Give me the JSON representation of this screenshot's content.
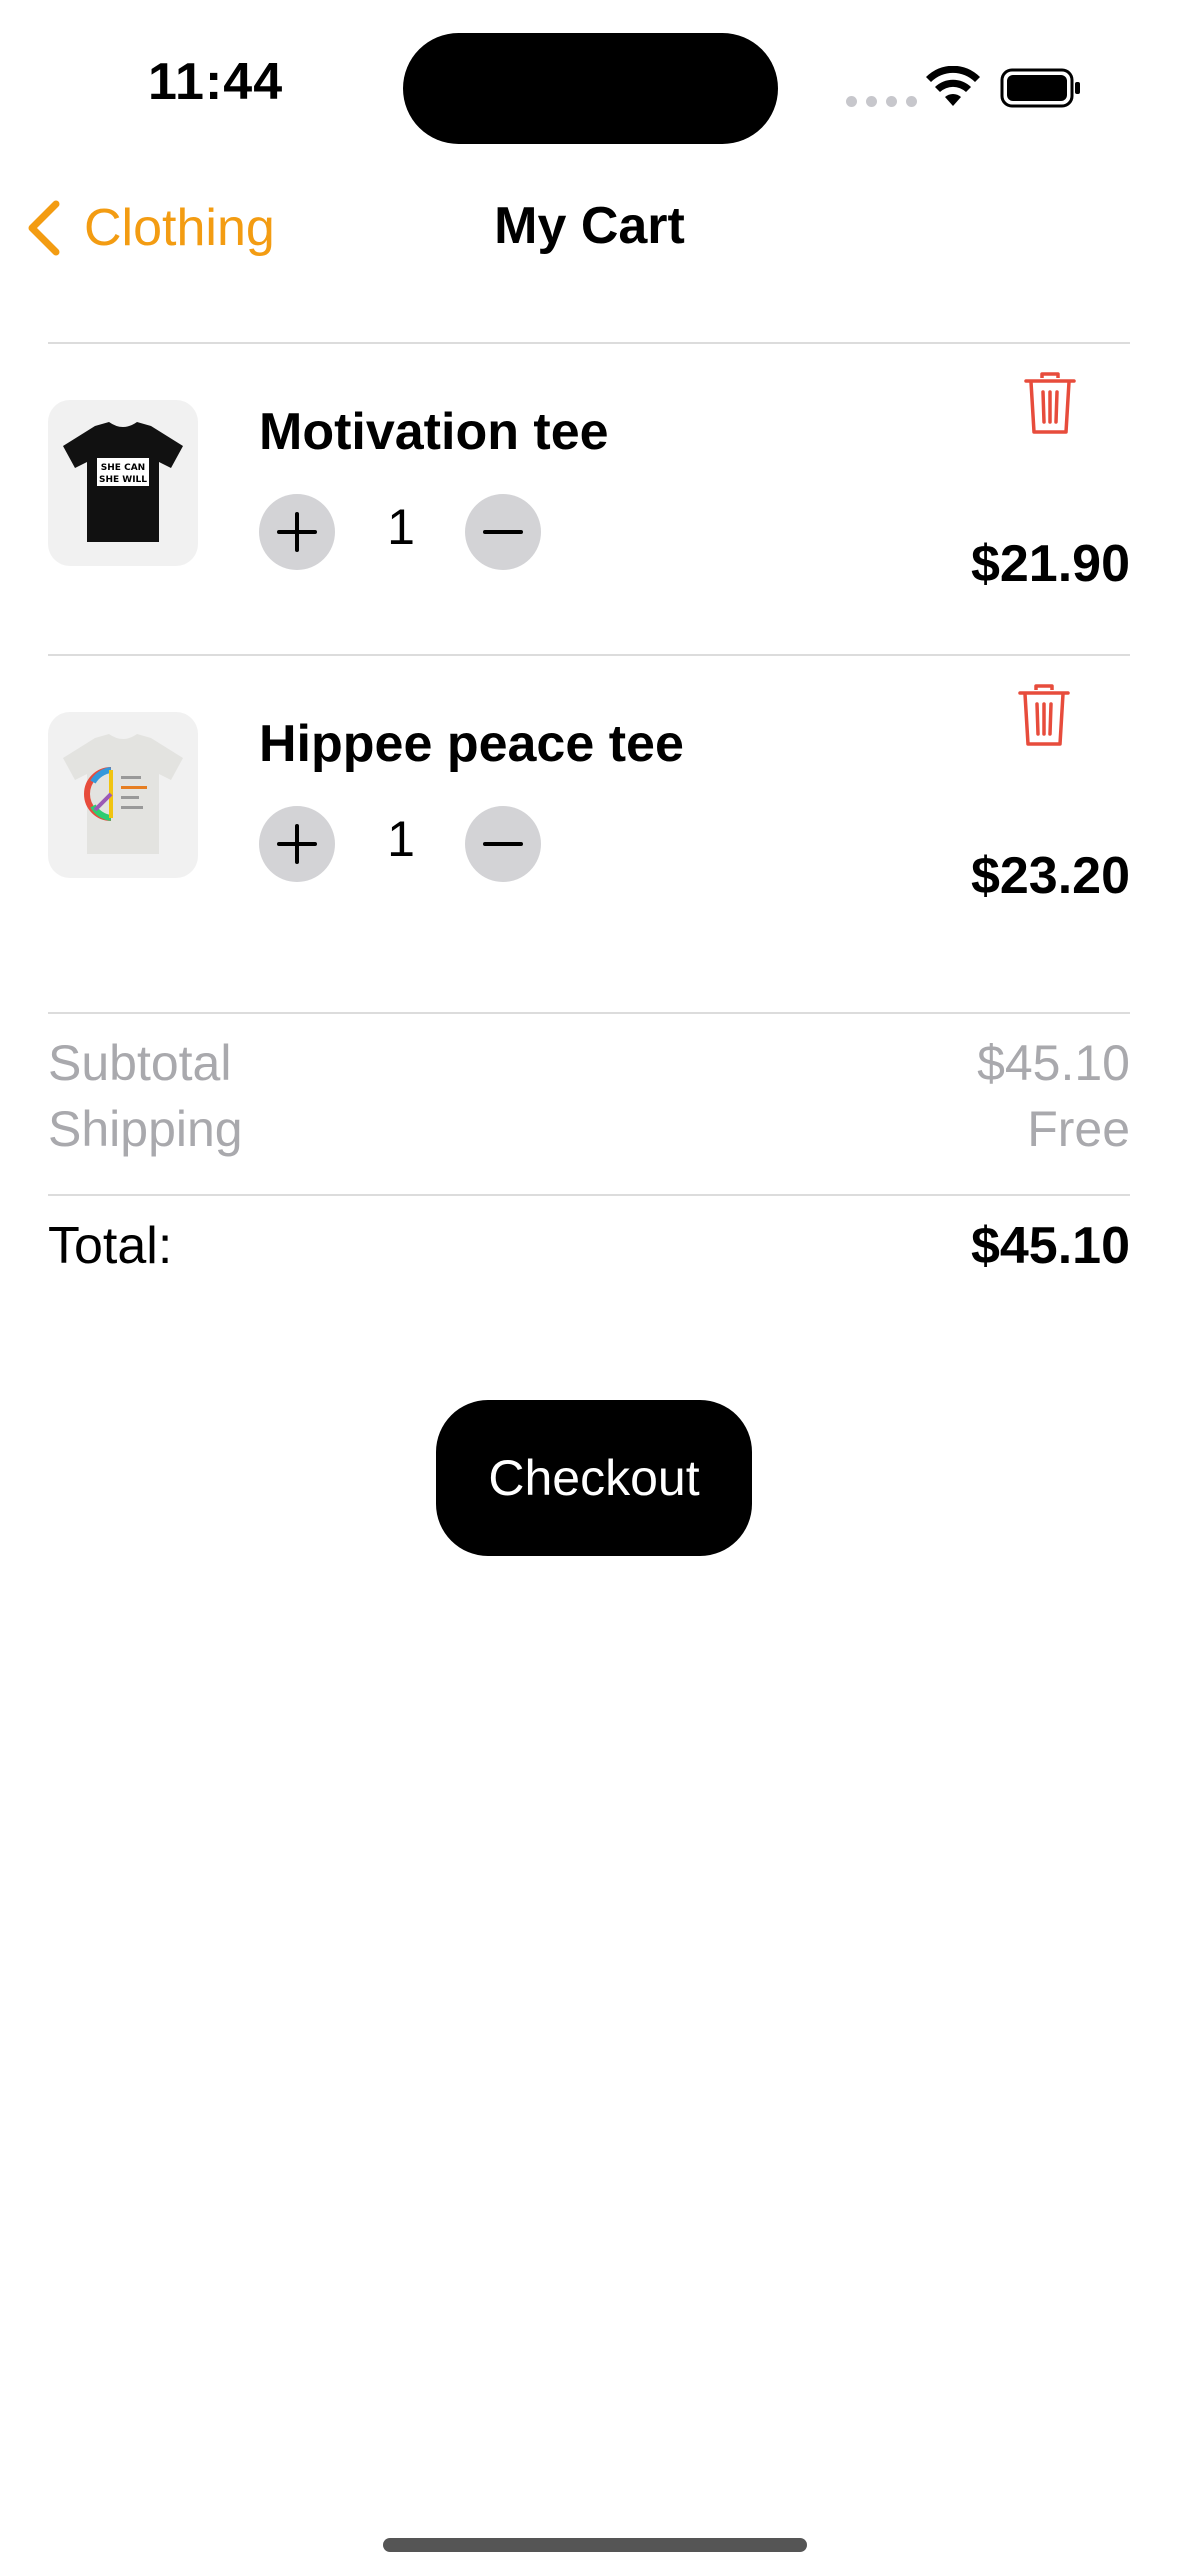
{
  "status_bar": {
    "time": "11:44"
  },
  "nav": {
    "back_label": "Clothing",
    "title": "My Cart",
    "accent_color": "#f39c12"
  },
  "cart": {
    "items": [
      {
        "name": "Motivation tee",
        "quantity": "1",
        "price": "$21.90",
        "thumbnail_icon": "black-tshirt-icon",
        "thumbnail_text": [
          "SHE CAN",
          "SHE WILL"
        ]
      },
      {
        "name": "Hippee peace tee",
        "quantity": "1",
        "price": "$23.20",
        "thumbnail_icon": "white-tshirt-peace-icon"
      }
    ]
  },
  "summary": {
    "subtotal_label": "Subtotal",
    "subtotal_value": "$45.10",
    "shipping_label": "Shipping",
    "shipping_value": "Free",
    "total_label": "Total:",
    "total_value": "$45.10"
  },
  "checkout": {
    "label": "Checkout"
  },
  "colors": {
    "delete": "#e74c3c",
    "muted_text": "#a9a9ad",
    "qty_button_bg": "#d3d3d6"
  }
}
